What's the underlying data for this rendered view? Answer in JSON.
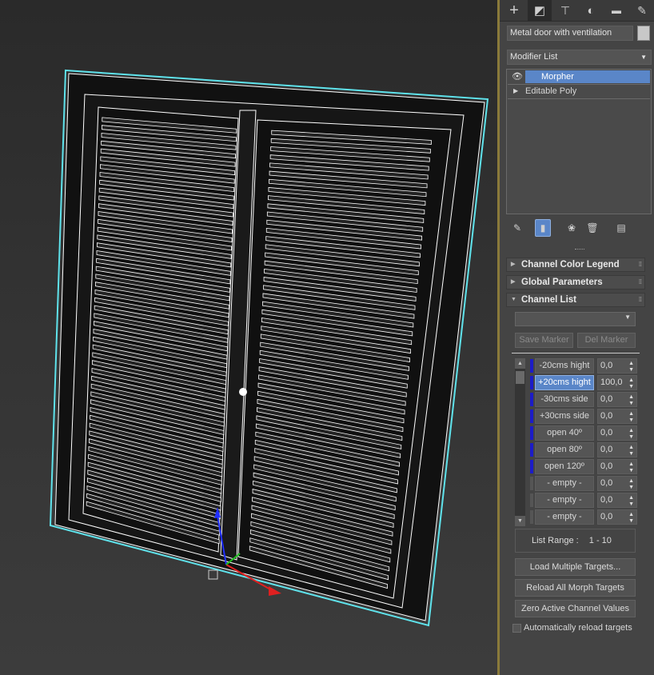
{
  "command_panel": {
    "tabs": [
      {
        "name": "create",
        "icon": "plus-icon",
        "glyph": "+"
      },
      {
        "name": "modify",
        "icon": "modify-icon",
        "glyph": "◩"
      },
      {
        "name": "hierarchy",
        "icon": "hierarchy-icon",
        "glyph": "⊤"
      },
      {
        "name": "motion",
        "icon": "motion-icon",
        "glyph": "◐"
      },
      {
        "name": "display",
        "icon": "display-icon",
        "glyph": "▬"
      },
      {
        "name": "utilities",
        "icon": "wrench-icon",
        "glyph": "✎"
      }
    ],
    "active_tab": "modify",
    "object_name": "Metal door with ventilation",
    "object_color": "#c8c8c8",
    "modifier_list_label": "Modifier List",
    "stack": [
      {
        "label": "Morpher",
        "selected": true,
        "visible_icon": "eye-icon"
      },
      {
        "label": "Editable Poly",
        "selected": false,
        "expandable": true
      }
    ],
    "stack_tools": [
      "pin-stack-icon",
      "show-end-result-icon",
      "make-unique-icon",
      "remove-modifier-icon",
      "configure-modifier-sets-icon"
    ]
  },
  "morpher": {
    "rollouts": {
      "channel_color_legend": "Channel Color Legend",
      "global_parameters": "Global Parameters",
      "channel_list": "Channel List"
    },
    "marker_dropdown_value": "",
    "save_marker": "Save Marker",
    "del_marker": "Del Marker",
    "channels": [
      {
        "name": "-20cms hight",
        "value": "0,0",
        "state": "target"
      },
      {
        "name": "+20cms hight",
        "value": "100,0",
        "state": "target",
        "selected": true
      },
      {
        "name": "-30cms side",
        "value": "0,0",
        "state": "target"
      },
      {
        "name": "+30cms side",
        "value": "0,0",
        "state": "target"
      },
      {
        "name": "open 40º",
        "value": "0,0",
        "state": "target"
      },
      {
        "name": "open 80º",
        "value": "0,0",
        "state": "target"
      },
      {
        "name": "open 120º",
        "value": "0,0",
        "state": "target"
      },
      {
        "name": "- empty -",
        "value": "0,0",
        "state": "empty"
      },
      {
        "name": "- empty -",
        "value": "0,0",
        "state": "empty"
      },
      {
        "name": "- empty -",
        "value": "0,0",
        "state": "empty"
      }
    ],
    "list_range_label": "List Range :",
    "list_range_value": "1 - 10",
    "load_multiple": "Load Multiple Targets...",
    "reload_all": "Reload All Morph Targets",
    "zero_active": "Zero Active Channel Values",
    "auto_reload_label": "Automatically reload targets",
    "auto_reload_checked": false
  },
  "viewport": {
    "selection_color": "#5fe3ec",
    "wire_color": "#ffffff",
    "gizmo_axes": [
      "x-axis",
      "y-axis",
      "z-axis"
    ]
  }
}
